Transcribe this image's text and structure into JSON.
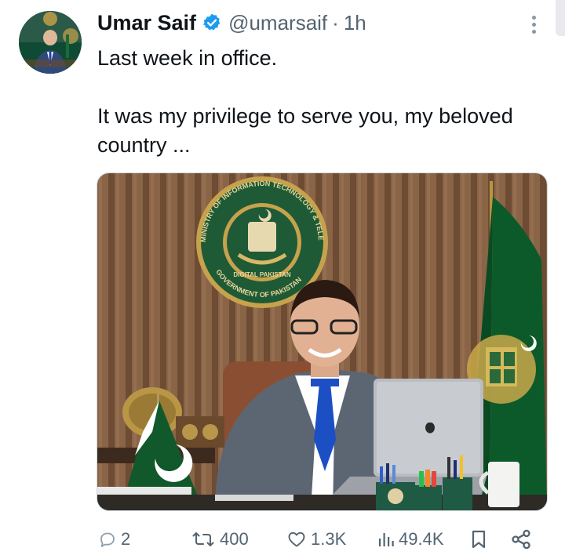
{
  "tweet": {
    "author_name": "Umar Saif",
    "handle": "@umarsaif",
    "separator": "·",
    "time": "1h",
    "line1": "Last week in office.",
    "line2": "It was my privilege to serve you, my beloved country ..."
  },
  "photo": {
    "seal_text_top": "MINISTRY OF INFORMATION TECHNOLOGY & TELECOM",
    "seal_text_bottom": "GOVERNMENT OF PAKISTAN",
    "seal_text_middle": "DIGITAL PAKISTAN"
  },
  "actions": {
    "replies": "2",
    "reposts": "400",
    "likes": "1.3K",
    "views": "49.4K"
  },
  "icons": [
    "more-icon",
    "verified-icon",
    "reply-icon",
    "repost-icon",
    "like-icon",
    "views-icon",
    "bookmark-icon",
    "share-icon"
  ],
  "colors": {
    "verified": "#1d9bf0",
    "secondary_text": "#536471",
    "flag_green": "#01411c"
  }
}
